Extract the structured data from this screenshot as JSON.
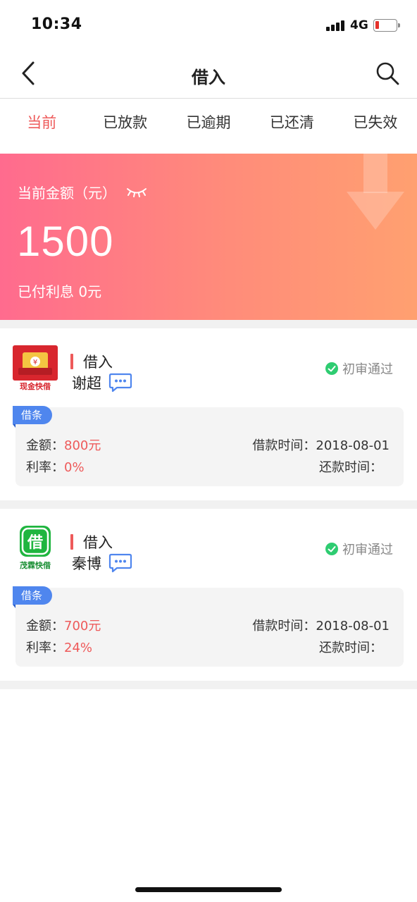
{
  "status_bar": {
    "time": "10:34",
    "network": "4G"
  },
  "nav": {
    "title": "借入"
  },
  "tabs": [
    {
      "label": "当前",
      "active": true
    },
    {
      "label": "已放款",
      "active": false
    },
    {
      "label": "已逾期",
      "active": false
    },
    {
      "label": "已还清",
      "active": false
    },
    {
      "label": "已失效",
      "active": false
    }
  ],
  "banner": {
    "label": "当前金额（元）",
    "amount": "1500",
    "interest": "已付利息 0元"
  },
  "loans": [
    {
      "logo_text": "现金快借",
      "type": "借入",
      "name": "谢超",
      "status": "初审通过",
      "tag": "借条",
      "amount_label": "金额：",
      "amount": "800元",
      "rate_label": "利率：",
      "rate": "0%",
      "borrow_time_label": "借款时间：",
      "borrow_time": "2018-08-01",
      "repay_time_label": "还款时间："
    },
    {
      "logo_text": "茂霖快借",
      "type": "借入",
      "name": "秦博",
      "status": "初审通过",
      "tag": "借条",
      "amount_label": "金额：",
      "amount": "700元",
      "rate_label": "利率：",
      "rate": "24%",
      "borrow_time_label": "借款时间：",
      "borrow_time": "2018-08-01",
      "repay_time_label": "还款时间："
    }
  ],
  "colors": {
    "accent": "#ee5a5a",
    "tag_blue": "#4f86ee",
    "status_green": "#2ecc71",
    "banner_start": "#ff6b8e",
    "banner_end": "#ffa070"
  },
  "icons": {
    "back": "chevron-left-icon",
    "search": "search-icon",
    "eye": "eye-closed-icon",
    "chat": "chat-bubble-icon",
    "status": "check-circle-icon"
  }
}
